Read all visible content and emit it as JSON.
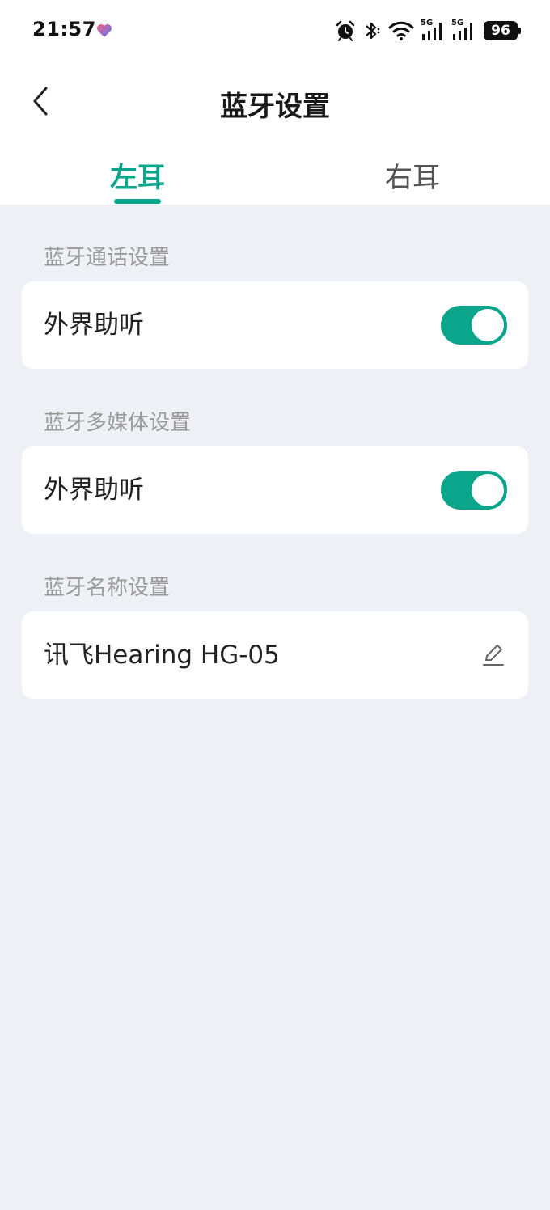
{
  "status_bar": {
    "time": "21:57",
    "battery": "96",
    "network_1": "5G",
    "network_2": "5G",
    "icons": [
      "heart-icon",
      "alarm-icon",
      "bluetooth-icon",
      "wifi-icon",
      "signal-icon",
      "signal-icon",
      "battery-icon"
    ]
  },
  "header": {
    "title": "蓝牙设置",
    "back_icon": "chevron-left-icon"
  },
  "tabs": [
    {
      "label": "左耳",
      "active": true
    },
    {
      "label": "右耳",
      "active": false
    }
  ],
  "sections": [
    {
      "title": "蓝牙通话设置",
      "item_label": "外界助听",
      "toggle_on": true
    },
    {
      "title": "蓝牙多媒体设置",
      "item_label": "外界助听",
      "toggle_on": true
    },
    {
      "title": "蓝牙名称设置",
      "item_label": "讯飞Hearing HG-05",
      "action_icon": "edit-icon"
    }
  ],
  "colors": {
    "accent": "#0aa58b",
    "background": "#eff0f5",
    "card": "#ffffff",
    "section_label": "#999999"
  }
}
